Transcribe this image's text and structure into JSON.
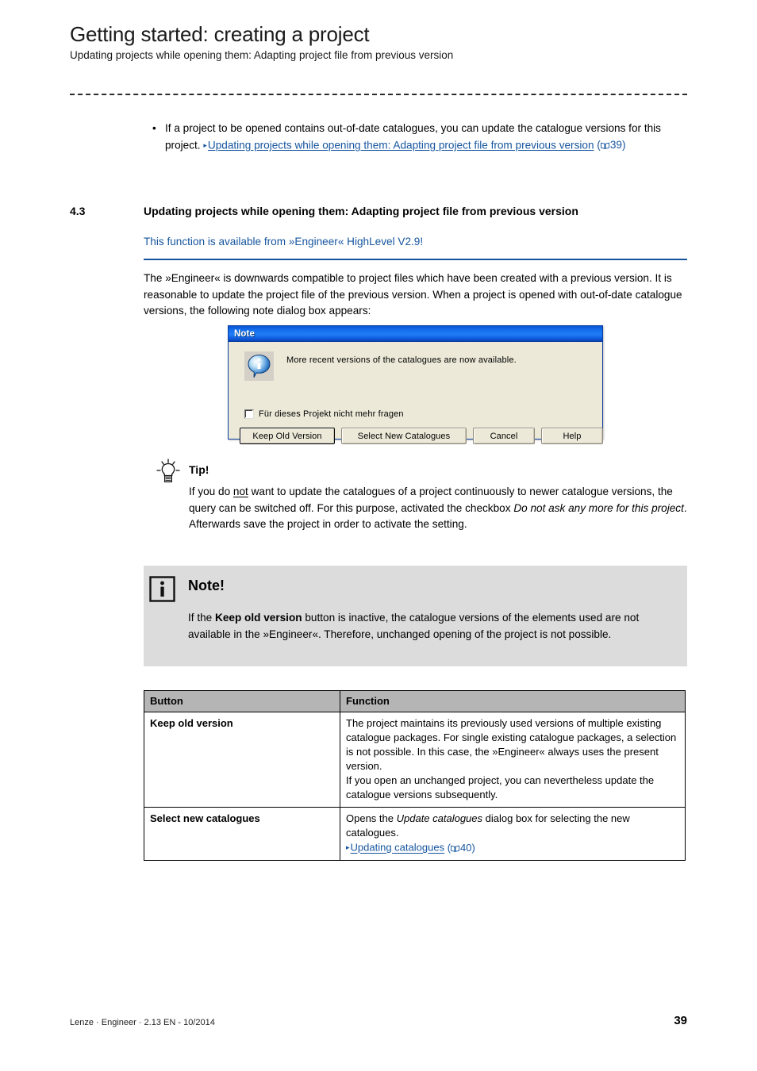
{
  "header": {
    "title": "Getting started: creating a project",
    "subtitle": "Updating projects while opening them: Adapting project file from previous version"
  },
  "intro_bullet": {
    "text_before_link": "If a project to be opened contains out-of-date catalogues, you can update the catalogue versions for this project.",
    "link_text": "Updating projects while opening them: Adapting project file from previous version",
    "page_ref": "39"
  },
  "section": {
    "number": "4.3",
    "title": "Updating projects while opening them: Adapting project file from previous version",
    "availability_note": "This function is available from »Engineer« HighLevel V2.9!",
    "accent_color": "#15559e"
  },
  "body_paragraph": "The »Engineer« is downwards compatible to project files which have been created with a previous version. It is reasonable to update the project file of the previous version. When a project is opened with out-of-date catalogue versions, the following note dialog box appears:",
  "dialog": {
    "title": "Note",
    "icon": "info-icon",
    "message": "More recent versions of the catalogues are now available.",
    "checkbox_label": "Für dieses Projekt nicht mehr fragen",
    "checkbox_checked": false,
    "buttons": [
      {
        "label": "Keep Old Version",
        "focused": true
      },
      {
        "label": "Select New Catalogues",
        "focused": false
      },
      {
        "label": "Cancel",
        "focused": false
      },
      {
        "label": "Help",
        "focused": false
      }
    ],
    "titlebar_color": "#1c78f2",
    "face_color": "#ece9d8"
  },
  "tip": {
    "icon": "lightbulb-icon",
    "title": "Tip!",
    "line1_a": "If you do ",
    "line1_not": "not",
    "line1_b": " want to update the catalogues of a project continuously to newer catalogue versions, the query can be switched off. For this purpose, activated the checkbox ",
    "emphasis": "Do not ask any more for this project",
    "line1_c": ". Afterwards save the project in order to activate the setting."
  },
  "note": {
    "icon": "info-square-icon",
    "title": "Note!",
    "text_a": "If the ",
    "bold": "Keep old version",
    "text_b": " button is inactive, the catalogue versions of the elements used are not available in the »Engineer«. Therefore, unchanged opening of the project is not possible.",
    "background_color": "#dcdcdc"
  },
  "table": {
    "headers": [
      "Button",
      "Function"
    ],
    "header_bg": "#b5b5b5",
    "rows": [
      {
        "button": "Keep old version",
        "function_p1": "The project maintains its previously used versions of multiple existing catalogue packages. For single existing catalogue packages, a selection is not possible. In this case, the »Engineer« always uses the present version.",
        "function_p2": "If you open an unchanged project, you can nevertheless update the catalogue versions subsequently.",
        "has_link": false
      },
      {
        "button": "Select new catalogues",
        "function_before": "Opens the ",
        "function_italic": "Update catalogues",
        "function_after": " dialog box for selecting the new catalogues.",
        "link_text": "Updating catalogues",
        "page_ref": "40",
        "has_link": true
      }
    ]
  },
  "footer": {
    "left": "Lenze · Engineer · 2.13 EN - 10/2014",
    "page_number": "39"
  }
}
